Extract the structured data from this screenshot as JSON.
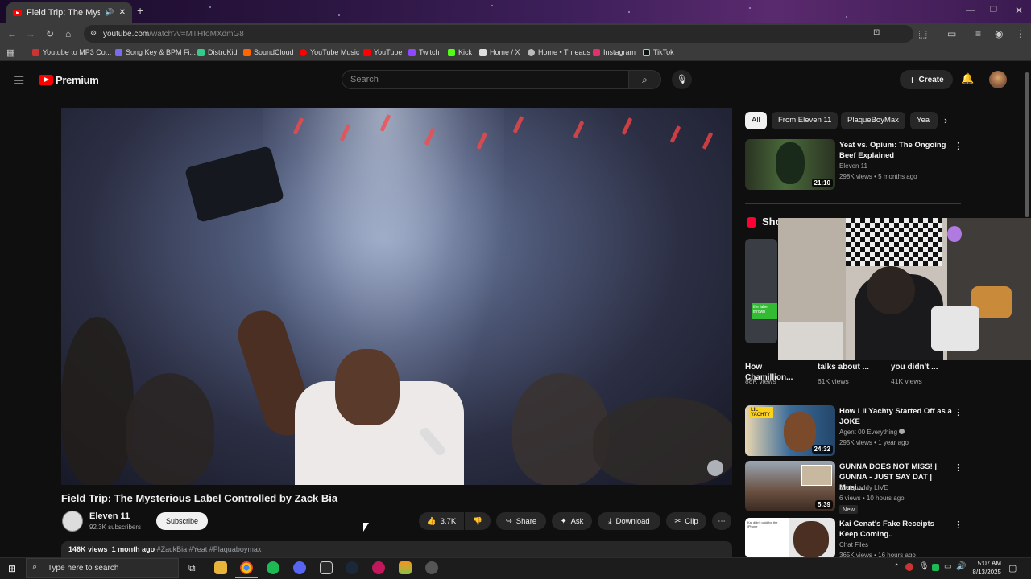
{
  "browser": {
    "tab_title": "Field Trip: The Mysterious L",
    "url_host": "youtube.com",
    "url_path": "/watch?v=MTHfoMXdmG8",
    "bookmarks": [
      "Youtube to MP3 Co...",
      "Song Key & BPM Fi...",
      "DistroKid",
      "SoundCloud",
      "YouTube Music",
      "YouTube",
      "Twitch",
      "Kick",
      "Home / X",
      "Home • Threads",
      "Instagram",
      "TikTok"
    ]
  },
  "yt_header": {
    "logo_text": "Premium",
    "search_placeholder": "Search",
    "create_label": "Create"
  },
  "video": {
    "title": "Field Trip: The Mysterious Label Controlled by Zack Bia",
    "channel": "Eleven 11",
    "subscribers": "92.3K subscribers",
    "subscribe_label": "Subscribe",
    "likes": "3.7K",
    "share_label": "Share",
    "ask_label": "Ask",
    "download_label": "Download",
    "clip_label": "Clip",
    "views": "146K views",
    "age": "1 month ago",
    "hashtags": "#ZackBia #Yeat #Plaquaboymax"
  },
  "chips": [
    "All",
    "From Eleven 11",
    "PlaqueBoyMax",
    "Yea"
  ],
  "related": [
    {
      "title": "Yeat vs. Opium: The Ongoing Beef Explained",
      "channel": "Eleven 11",
      "meta": "298K views • 5 months ago",
      "duration": "21:10",
      "color": "#2d3a2a"
    },
    {
      "title": "How Lil Yachty Started Off as a JOKE",
      "channel": "Agent 00 Everything",
      "meta": "295K views • 1 year ago",
      "duration": "24:32",
      "color": "#3a6b9a"
    },
    {
      "title": "GUNNA DOES NOT MISS! | GUNNA - JUST SAY DAT | Musi...",
      "channel": "Justquaddy LIVE",
      "meta": "6 views • 10 hours ago",
      "badge": "New",
      "duration": "5:39",
      "color": "#6a5040"
    },
    {
      "title": "Kai Cenat's Fake Receipts Keep Coming..",
      "channel": "Chat Files",
      "meta": "365K views • 16 hours ago",
      "duration": "",
      "color": "#d8d8d8"
    }
  ],
  "shorts": {
    "label": "Sho",
    "items": [
      {
        "title": "How Chamillion...",
        "views": "88K views"
      },
      {
        "title": "talks about ...",
        "views": "61K views"
      },
      {
        "title": "you didn't ...",
        "views": "41K views"
      }
    ]
  },
  "taskbar": {
    "search_placeholder": "Type here to search",
    "time": "5:07 AM",
    "date": "8/13/2025"
  }
}
